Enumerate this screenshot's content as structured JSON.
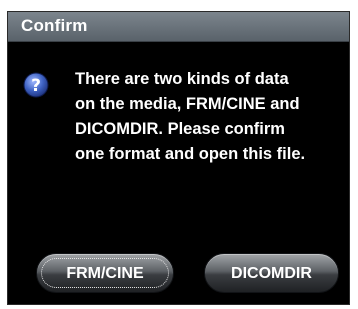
{
  "dialog": {
    "title": "Confirm",
    "icon": "question-icon",
    "message": "There are two kinds of data\non the media, FRM/CINE and\nDICOMDIR. Please confirm\none format and open this file.",
    "buttons": {
      "frm_cine_label": "FRM/CINE",
      "dicomdir_label": "DICOMDIR"
    }
  },
  "colors": {
    "dialog_background": "#000000",
    "titlebar": "#6a737b",
    "text": "#ffffff",
    "icon": "#2b4ea8"
  }
}
